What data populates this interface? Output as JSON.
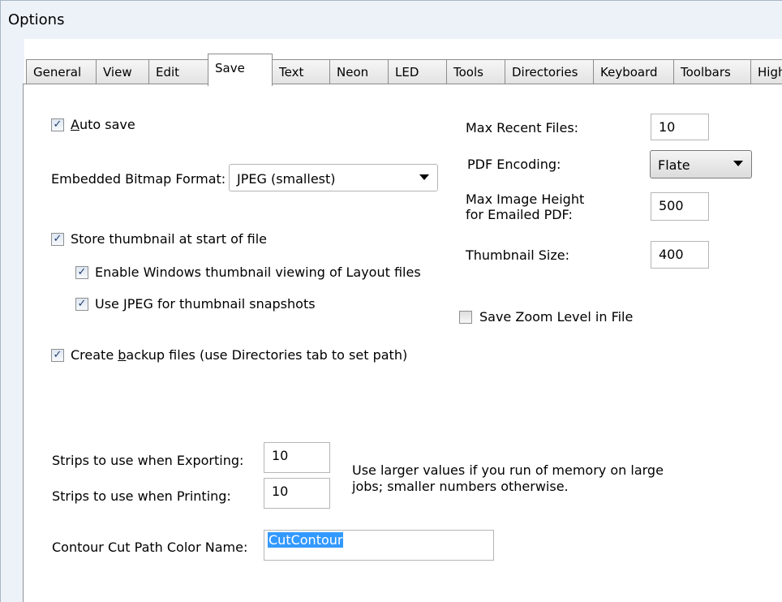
{
  "window": {
    "title": "Options"
  },
  "tabs": [
    {
      "label": "General"
    },
    {
      "label": "View"
    },
    {
      "label": "Edit"
    },
    {
      "label": "Save"
    },
    {
      "label": "Text"
    },
    {
      "label": "Neon"
    },
    {
      "label": "LED"
    },
    {
      "label": "Tools"
    },
    {
      "label": "Directories"
    },
    {
      "label": "Keyboard"
    },
    {
      "label": "Toolbars"
    },
    {
      "label": "High"
    }
  ],
  "active_tab": "Save",
  "left": {
    "auto_save": {
      "label_u": "A",
      "label_rest": "uto save",
      "checked": true
    },
    "bitmap_format": {
      "label": "Embedded Bitmap Format:",
      "value": "JPEG (smallest)"
    },
    "store_thumbnail": {
      "label": "Store thumbnail at start of file",
      "checked": true
    },
    "enable_windows_thumb": {
      "label": "Enable Windows thumbnail viewing of Layout files",
      "checked": true
    },
    "use_jpeg_thumb": {
      "label": "Use JPEG for thumbnail snapshots",
      "checked": true
    },
    "create_backup": {
      "label_pre": "Create ",
      "label_u": "b",
      "label_rest": "ackup files (use Directories tab to set path)",
      "checked": true
    }
  },
  "right": {
    "max_recent": {
      "label": "Max Recent Files:",
      "value": "10"
    },
    "pdf_encoding": {
      "label": "PDF Encoding:",
      "value": "Flate"
    },
    "max_image_height": {
      "label_line1": "Max Image Height",
      "label_line2": "for Emailed PDF:",
      "value": "500"
    },
    "thumbnail_size": {
      "label": "Thumbnail Size:",
      "value": "400"
    },
    "save_zoom": {
      "label": "Save Zoom Level in File",
      "checked": false
    }
  },
  "bottom": {
    "strips_export": {
      "label": "Strips to use when Exporting:",
      "value": "10"
    },
    "strips_print": {
      "label": "Strips to use when Printing:",
      "value": "10"
    },
    "strips_note_line1": "Use larger values if you run of memory on large",
    "strips_note_line2": "jobs; smaller numbers otherwise.",
    "contour": {
      "label": "Contour Cut Path Color Name:",
      "value": "CutContour"
    }
  },
  "icons": {
    "check": "checkmark-icon",
    "dropdown": "chevron-down-icon"
  }
}
